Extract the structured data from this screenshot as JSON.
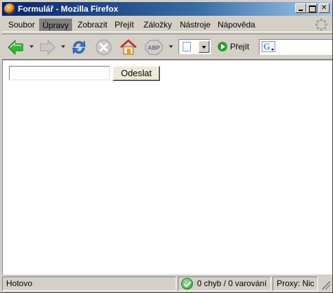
{
  "window": {
    "title": "Formulář - Mozilla Firefox"
  },
  "menubar": {
    "items": [
      {
        "label": "Soubor"
      },
      {
        "label": "Úpravy",
        "active": true
      },
      {
        "label": "Zobrazit"
      },
      {
        "label": "Přejít"
      },
      {
        "label": "Záložky"
      },
      {
        "label": "Nástroje"
      },
      {
        "label": "Nápověda"
      }
    ]
  },
  "toolbar": {
    "buttons": [
      "back-icon",
      "forward-icon",
      "reload-icon",
      "stop-icon",
      "home-icon",
      "adblock-icon"
    ],
    "adblock_label": "ABP",
    "go_label": "Přejít",
    "search_engine_letter": "G"
  },
  "form": {
    "input_value": "",
    "submit_label": "Odeslat"
  },
  "statusbar": {
    "status": "Hotovo",
    "errors": "0 chyb / 0 varování",
    "proxy": "Proxy: Nic"
  },
  "colors": {
    "titlebar_start": "#0a246a",
    "titlebar_end": "#a6caf0",
    "chrome": "#d4d0c8",
    "back_arrow": "#3bb43b",
    "reload": "#2a7be0"
  }
}
